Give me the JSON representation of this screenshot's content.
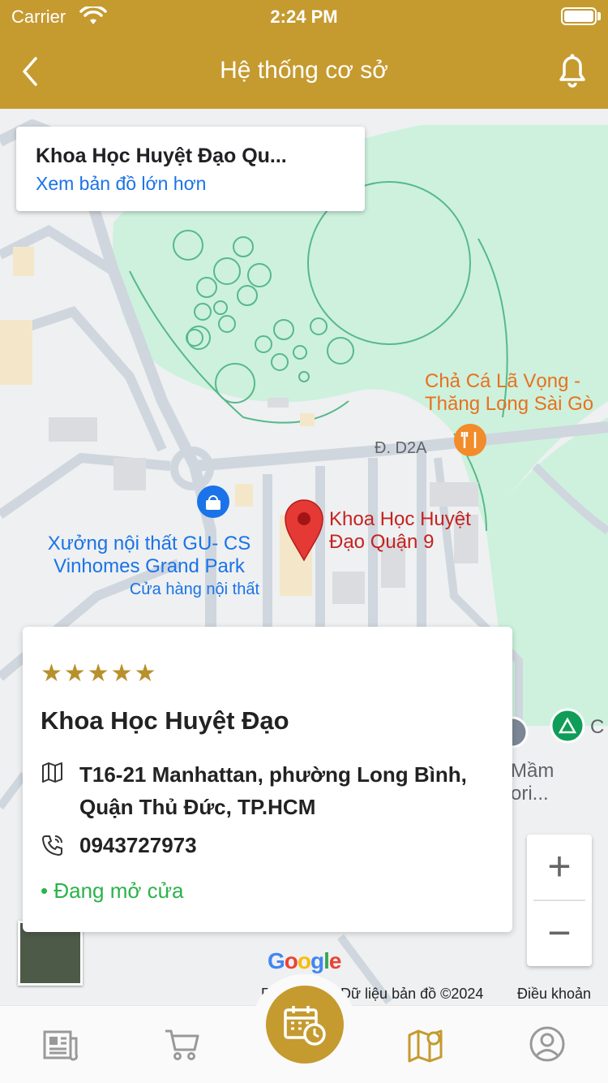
{
  "status_bar": {
    "carrier": "Carrier",
    "time": "2:24 PM"
  },
  "header": {
    "title": "Hệ thống cơ sở"
  },
  "map": {
    "card_title": "Khoa Học Huyệt Đạo Qu...",
    "card_link": "Xem bản đồ lớn hơn",
    "pin_label_1": "Khoa Học Huyệt",
    "pin_label_2": "Đạo Quận 9",
    "restaurant_label_1": "Chả Cá Lã Vọng -",
    "restaurant_label_2": "Thăng Long Sài Gò",
    "store_label_1": "Xưởng nội thất GU- CS",
    "store_label_2": "Vinhomes Grand Park",
    "store_category": "Cửa hàng nội thất",
    "road_d2a": "Đ. D2A",
    "school_label_1": "Mầm",
    "school_label_2": "ori...",
    "edge_label": "C",
    "google": "Google",
    "footer_left": "Phí",
    "footer_data": "Dữ liệu bản đồ ©2024",
    "footer_terms": "Điều khoản",
    "zoom_in": "+",
    "zoom_out": "−",
    "colors": {
      "park": "#cdf1dd",
      "park_line": "#57b98a",
      "road": "#cfd6de",
      "pin": "#e53935",
      "accent": "#c59a2f"
    }
  },
  "info_card": {
    "rating": "★★★★★",
    "name": "Khoa Học Huyệt Đạo",
    "address": "T16-21 Manhattan, phường Long Bình, Quận Thủ Đức, TP.HCM",
    "phone": "0943727973",
    "status": "• Đang mở cửa"
  },
  "bottom_nav": {
    "items": [
      "news-icon",
      "cart-icon",
      "calendar-icon",
      "map-icon",
      "profile-icon"
    ],
    "active": "map-icon"
  }
}
